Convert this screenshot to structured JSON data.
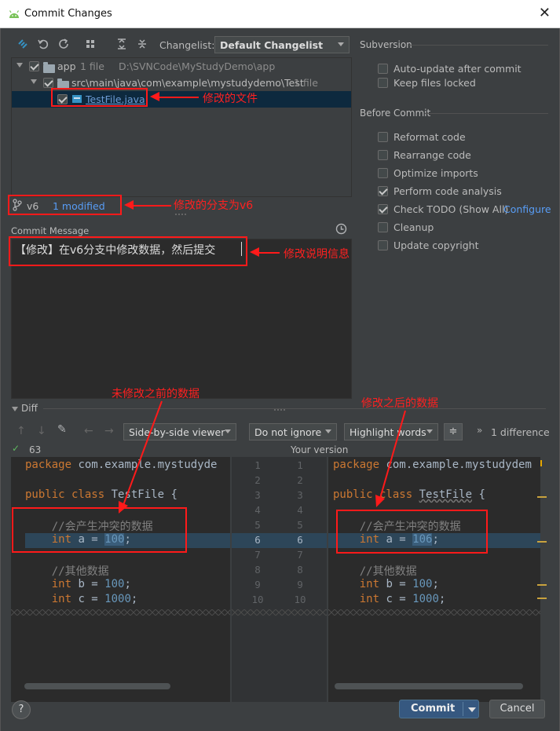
{
  "window": {
    "title": "Commit Changes",
    "close_glyph": "✕"
  },
  "toolbar": {
    "changelist_label": "Changelist:",
    "changelist_value": "Default Changelist"
  },
  "tree": {
    "root": {
      "name": "app",
      "count": "1 file",
      "path": "D:\\SVNCode\\MyStudyDemo\\app"
    },
    "package": {
      "name": "src\\main\\java\\com\\example\\mystudydemo\\Test",
      "count": "1 file"
    },
    "file": {
      "name": "TestFile.java"
    }
  },
  "branch": {
    "name": "v6",
    "status": "1 modified"
  },
  "commit_message": {
    "label": "Commit Message",
    "value": "【修改】在v6分支中修改数据，然后提交"
  },
  "subversion": {
    "title": "Subversion",
    "options": [
      {
        "label": "Auto-update after commit",
        "checked": false
      },
      {
        "label": "Keep files locked",
        "checked": false
      }
    ]
  },
  "before_commit": {
    "title": "Before Commit",
    "options": [
      {
        "label": "Reformat code",
        "checked": false
      },
      {
        "label": "Rearrange code",
        "checked": false
      },
      {
        "label": "Optimize imports",
        "checked": false
      },
      {
        "label": "Perform code analysis",
        "checked": true
      },
      {
        "label": "Check TODO (Show All)",
        "checked": true
      },
      {
        "label": "Cleanup",
        "checked": false
      },
      {
        "label": "Update copyright",
        "checked": false
      }
    ],
    "configure_link": "Configure"
  },
  "diff": {
    "title": "Diff",
    "viewer": "Side-by-side viewer",
    "ignore": "Do not ignore",
    "highlight": "Highlight words",
    "difference_count": "1 difference",
    "left_header": "63",
    "right_header": "Your version",
    "left_lines": [
      "package com.example.mystudyde",
      "",
      "public class TestFile {",
      "",
      "    //会产生冲突的数据",
      "    int a = 100;",
      "",
      "    //其他数据",
      "    int b = 100;",
      "    int c = 1000;"
    ],
    "right_lines": [
      "package com.example.mystudydem",
      "",
      "public class TestFile {",
      "",
      "    //会产生冲突的数据",
      "    int a = 106;",
      "",
      "    //其他数据",
      "    int b = 100;",
      "    int c = 1000;"
    ],
    "line_numbers": [
      "1",
      "2",
      "3",
      "4",
      "5",
      "6",
      "7",
      "8",
      "9",
      "10"
    ]
  },
  "annotations": {
    "file": "修改的文件",
    "branch": "修改的分支为v6",
    "message": "修改说明信息",
    "before": "未修改之前的数据",
    "after": "修改之后的数据"
  },
  "buttons": {
    "commit": "Commit",
    "cancel": "Cancel",
    "help": "?"
  },
  "colors": {
    "accent": "#365880",
    "annotation_red": "#ff1a1a",
    "link": "#589df6"
  }
}
